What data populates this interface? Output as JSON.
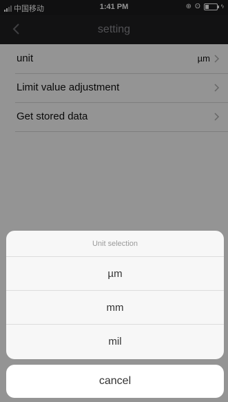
{
  "status_bar": {
    "carrier": "中国移动",
    "time": "1:41 PM",
    "icons": [
      "signal-icon",
      "alarm-icon",
      "orientation-lock-icon",
      "battery-icon",
      "charging-icon"
    ]
  },
  "nav": {
    "title": "setting",
    "back_icon": "chevron-left-icon"
  },
  "settings": {
    "items": [
      {
        "label": "unit",
        "value": "µm"
      },
      {
        "label": "Limit value adjustment",
        "value": ""
      },
      {
        "label": "Get stored data",
        "value": ""
      }
    ]
  },
  "sheet": {
    "title": "Unit selection",
    "options": [
      "µm",
      "mm",
      "mil"
    ],
    "cancel": "cancel"
  }
}
